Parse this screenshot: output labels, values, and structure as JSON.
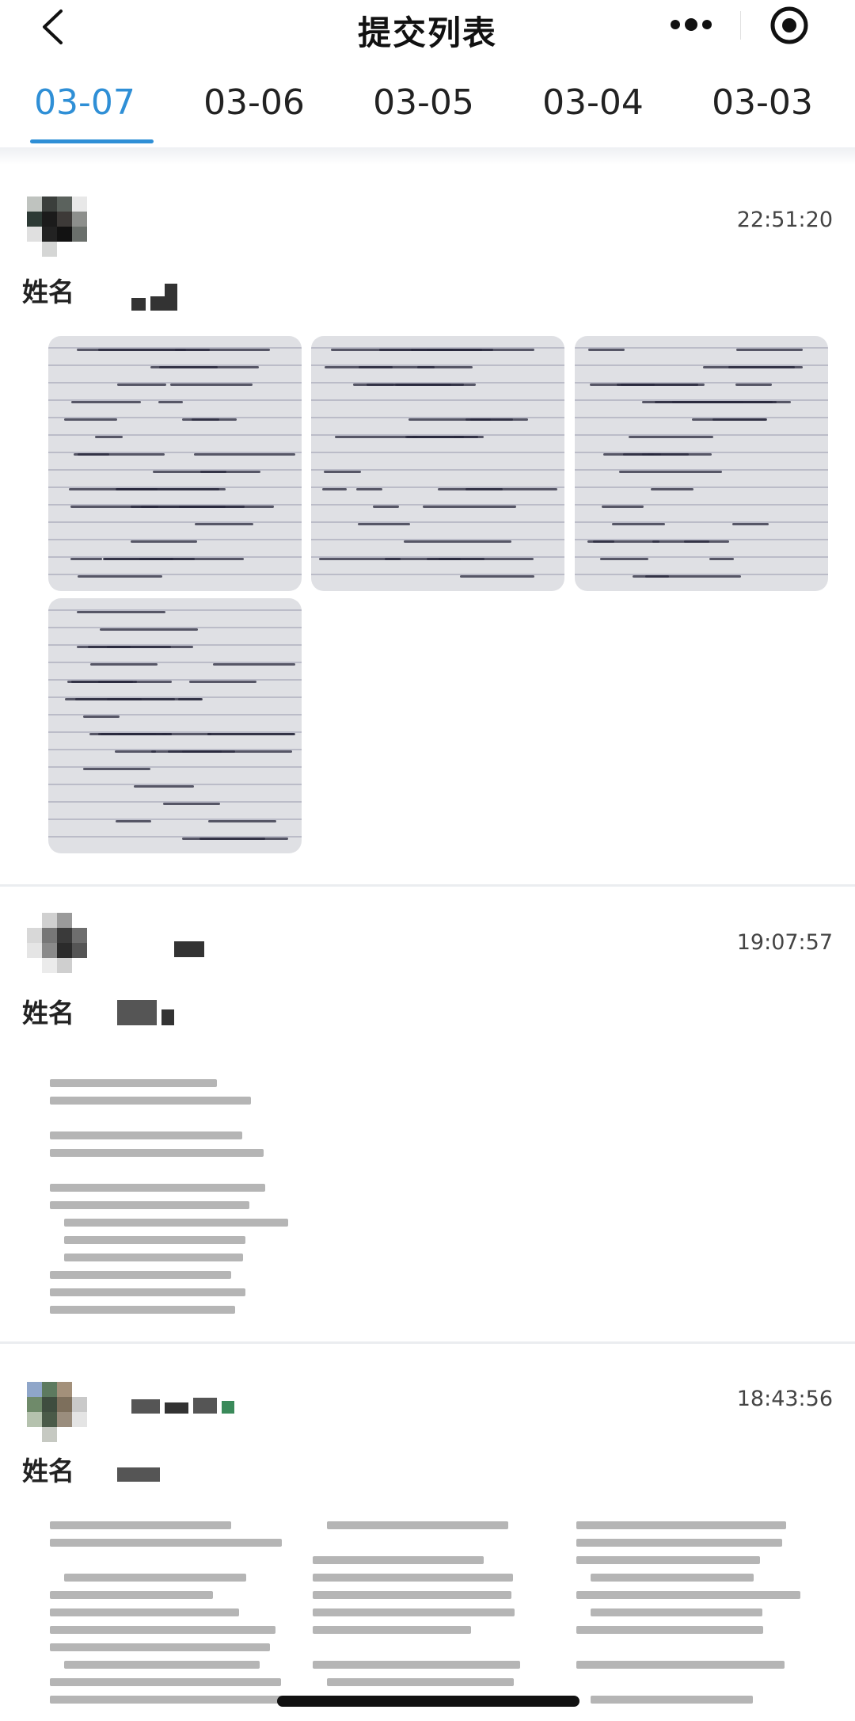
{
  "header": {
    "title": "提交列表",
    "back_icon": "chevron-left-icon",
    "more_icon": "more-dots-icon",
    "close_icon": "target-circle-icon"
  },
  "tabs": [
    {
      "label": "03-07",
      "active": true
    },
    {
      "label": "03-06",
      "active": false
    },
    {
      "label": "03-05",
      "active": false
    },
    {
      "label": "03-04",
      "active": false
    },
    {
      "label": "03-03",
      "active": false
    }
  ],
  "colors": {
    "accent": "#2f8fd6",
    "separator": "#ebedf0"
  },
  "submissions": [
    {
      "time": "22:51:20",
      "name_label": "姓名",
      "attachments": "4 handwritten note photos"
    },
    {
      "time": "19:07:57",
      "name_label": "姓名",
      "attachments": "1 document image"
    },
    {
      "time": "18:43:56",
      "name_label": "姓名",
      "attachments": "3 document images"
    }
  ]
}
